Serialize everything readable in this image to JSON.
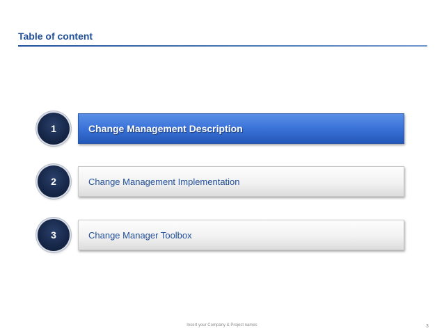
{
  "header": {
    "title": "Table of content"
  },
  "items": [
    {
      "number": "1",
      "label": "Change Management Description",
      "active": true
    },
    {
      "number": "2",
      "label": "Change Management Implementation",
      "active": false
    },
    {
      "number": "3",
      "label": "Change Manager Toolbox",
      "active": false
    }
  ],
  "footer": {
    "text": "Insert your Company & Project names",
    "page": "3"
  },
  "colors": {
    "title": "#1f4e99",
    "active_box": "#3a72d8",
    "number_circle": "#17284a"
  }
}
